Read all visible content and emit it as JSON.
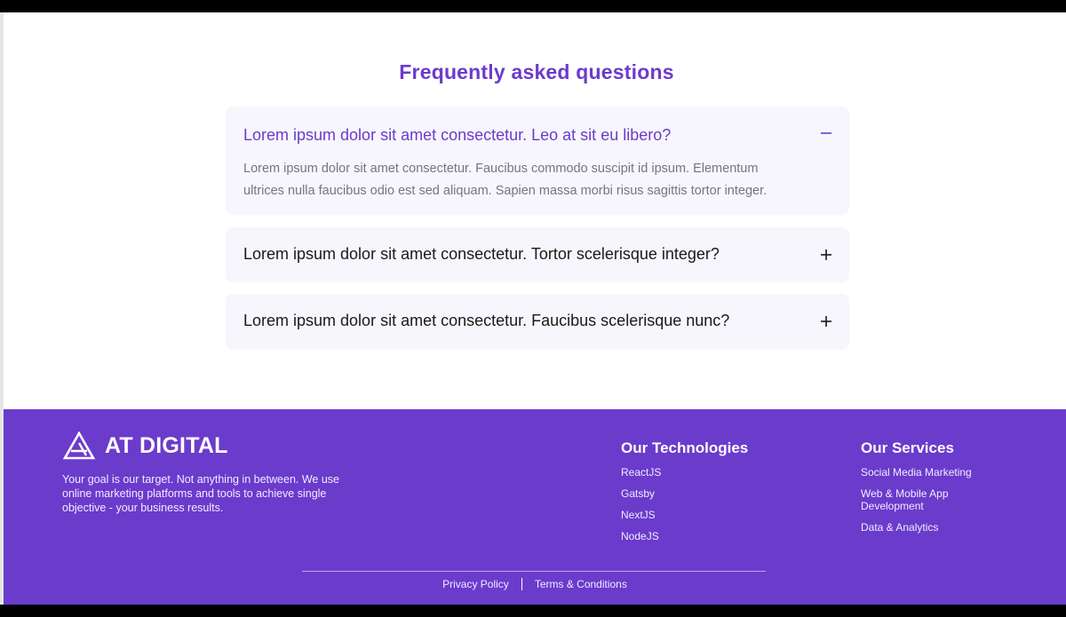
{
  "faq": {
    "title": "Frequently asked questions",
    "items": [
      {
        "question": "Lorem ipsum dolor sit amet consectetur. Leo at sit eu libero?",
        "answer_line1": "Lorem ipsum dolor sit amet consectetur. Faucibus commodo suscipit id ipsum. Elementum",
        "answer_line2": "ultrices nulla faucibus odio est sed aliquam. Sapien massa morbi risus sagittis tortor integer.",
        "icon": "minus-icon",
        "expanded": true
      },
      {
        "question": "Lorem ipsum dolor sit amet consectetur. Tortor scelerisque integer?",
        "icon": "plus-icon",
        "expanded": false
      },
      {
        "question": "Lorem ipsum dolor sit amet consectetur. Faucibus scelerisque nunc?",
        "icon": "plus-icon",
        "expanded": false
      }
    ]
  },
  "footer": {
    "brand": "AT DIGITAL",
    "tagline": "Your goal is our target. Not anything in between. We use online marketing platforms and tools to achieve single objective - your business results.",
    "technologies": {
      "title": "Our Technologies",
      "items": [
        "ReactJS",
        "Gatsby",
        "NextJS",
        "NodeJS"
      ]
    },
    "services": {
      "title": "Our Services",
      "items": [
        "Social Media Marketing",
        "Web & Mobile App Development",
        "Data & Analytics"
      ]
    },
    "legal": {
      "privacy": "Privacy Policy",
      "terms": "Terms & Conditions"
    }
  },
  "colors": {
    "accent": "#6b3bcc",
    "card_bg": "#f7f6fc",
    "body_text": "#767480"
  }
}
